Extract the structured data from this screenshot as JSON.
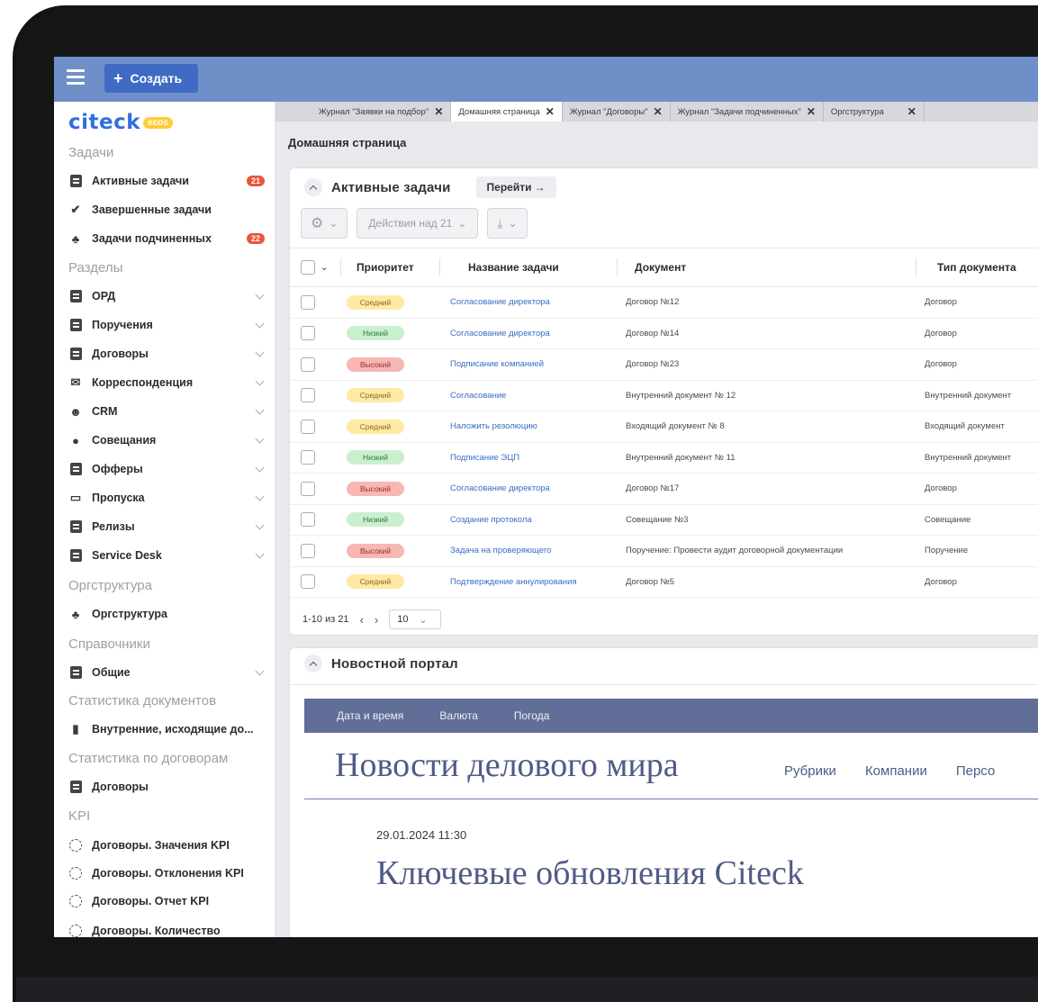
{
  "topbar": {
    "create_label": "Создать"
  },
  "sidebar": {
    "logo_text": "citeck",
    "logo_badge": "ecos",
    "sections": {
      "tasks": "Задачи",
      "sections": "Разделы",
      "orgstructure": "Оргструктура",
      "references": "Справочники",
      "doc_stats": "Статистика документов",
      "contract_stats": "Статистика по договорам",
      "kpi": "KPI"
    },
    "task_items": [
      {
        "label": "Активные задачи",
        "badge": "21"
      },
      {
        "label": "Завершенные задачи"
      },
      {
        "label": "Задачи подчиненных",
        "badge": "22"
      }
    ],
    "section_items": [
      {
        "label": "ОРД"
      },
      {
        "label": "Поручения"
      },
      {
        "label": "Договоры"
      },
      {
        "label": "Корреспонденция"
      },
      {
        "label": "CRM"
      },
      {
        "label": "Совещания"
      },
      {
        "label": "Офферы"
      },
      {
        "label": "Пропуска"
      },
      {
        "label": "Релизы"
      },
      {
        "label": "Service Desk"
      }
    ],
    "org_items": [
      {
        "label": "Оргструктура"
      }
    ],
    "ref_items": [
      {
        "label": "Общие"
      }
    ],
    "doc_stat_items": [
      {
        "label": "Внутренние, исходящие до..."
      }
    ],
    "contract_stat_items": [
      {
        "label": "Договоры"
      }
    ],
    "kpi_items": [
      {
        "label": "Договоры. Значения KPI"
      },
      {
        "label": "Договоры. Отклонения KPI"
      },
      {
        "label": "Договоры. Отчет KPI"
      },
      {
        "label": "Договоры. Количество"
      }
    ]
  },
  "tabs": [
    {
      "label": "Журнал \"Заявки на подбор\""
    },
    {
      "label": "Домашняя страница",
      "active": true
    },
    {
      "label": "Журнал \"Договоры\""
    },
    {
      "label": "Журнал \"Задачи подчиненных\""
    },
    {
      "label": "Оргструктура"
    }
  ],
  "page_title": "Домашняя страница",
  "tasks_widget": {
    "title": "Активные задачи",
    "goto_label": "Перейти →",
    "actions_label": "Действия над 21",
    "columns": {
      "priority": "Приоритет",
      "name": "Название задачи",
      "document": "Документ",
      "doc_type": "Тип документа"
    },
    "rows": [
      {
        "priority": "Средний",
        "level": "mid",
        "name": "Согласование директора",
        "document": "Договор №12",
        "doc_type": "Договор"
      },
      {
        "priority": "Низкий",
        "level": "low",
        "name": "Согласование директора",
        "document": "Договор №14",
        "doc_type": "Договор"
      },
      {
        "priority": "Высокий",
        "level": "high",
        "name": "Подписание компанией",
        "document": "Договор №23",
        "doc_type": "Договор"
      },
      {
        "priority": "Средний",
        "level": "mid",
        "name": "Согласование",
        "document": "Внутренний документ № 12",
        "doc_type": "Внутренний документ"
      },
      {
        "priority": "Средний",
        "level": "mid",
        "name": "Наложить резолюцию",
        "document": "Входящий документ № 8",
        "doc_type": "Входящий документ"
      },
      {
        "priority": "Низкий",
        "level": "low",
        "name": "Подписание ЭЦП",
        "document": "Внутренний документ № 11",
        "doc_type": "Внутренний документ"
      },
      {
        "priority": "Высокий",
        "level": "high",
        "name": "Согласование директора",
        "document": "Договор №17",
        "doc_type": "Договор"
      },
      {
        "priority": "Низкий",
        "level": "low",
        "name": "Создание протокола",
        "document": "Совещание №3",
        "doc_type": "Совещание"
      },
      {
        "priority": "Высокий",
        "level": "high",
        "name": "Задача на проверяющего",
        "document": "Поручение: Провести аудит договорной документации",
        "doc_type": "Поручение"
      },
      {
        "priority": "Средний",
        "level": "mid",
        "name": "Подтверждение аннулирования",
        "document": "Договор №5",
        "doc_type": "Договор"
      }
    ],
    "pager": {
      "range": "1-10 из 21",
      "per_page": "10"
    }
  },
  "news_widget": {
    "title": "Новостной портал",
    "bar_items": [
      "Дата и время",
      "Валюта",
      "Погода"
    ],
    "brand": "Новости делового мира",
    "nav": [
      "Рубрики",
      "Компании",
      "Персо"
    ],
    "date": "29.01.2024 11:30",
    "headline": "Ключевые обновления Citeck"
  },
  "colors": {
    "topbar": "#6f8fc8",
    "create_button": "#3f6bc4",
    "brand_blue": "#2f6fdf",
    "badge_red": "#e8553c",
    "news_bar": "#616e97"
  }
}
